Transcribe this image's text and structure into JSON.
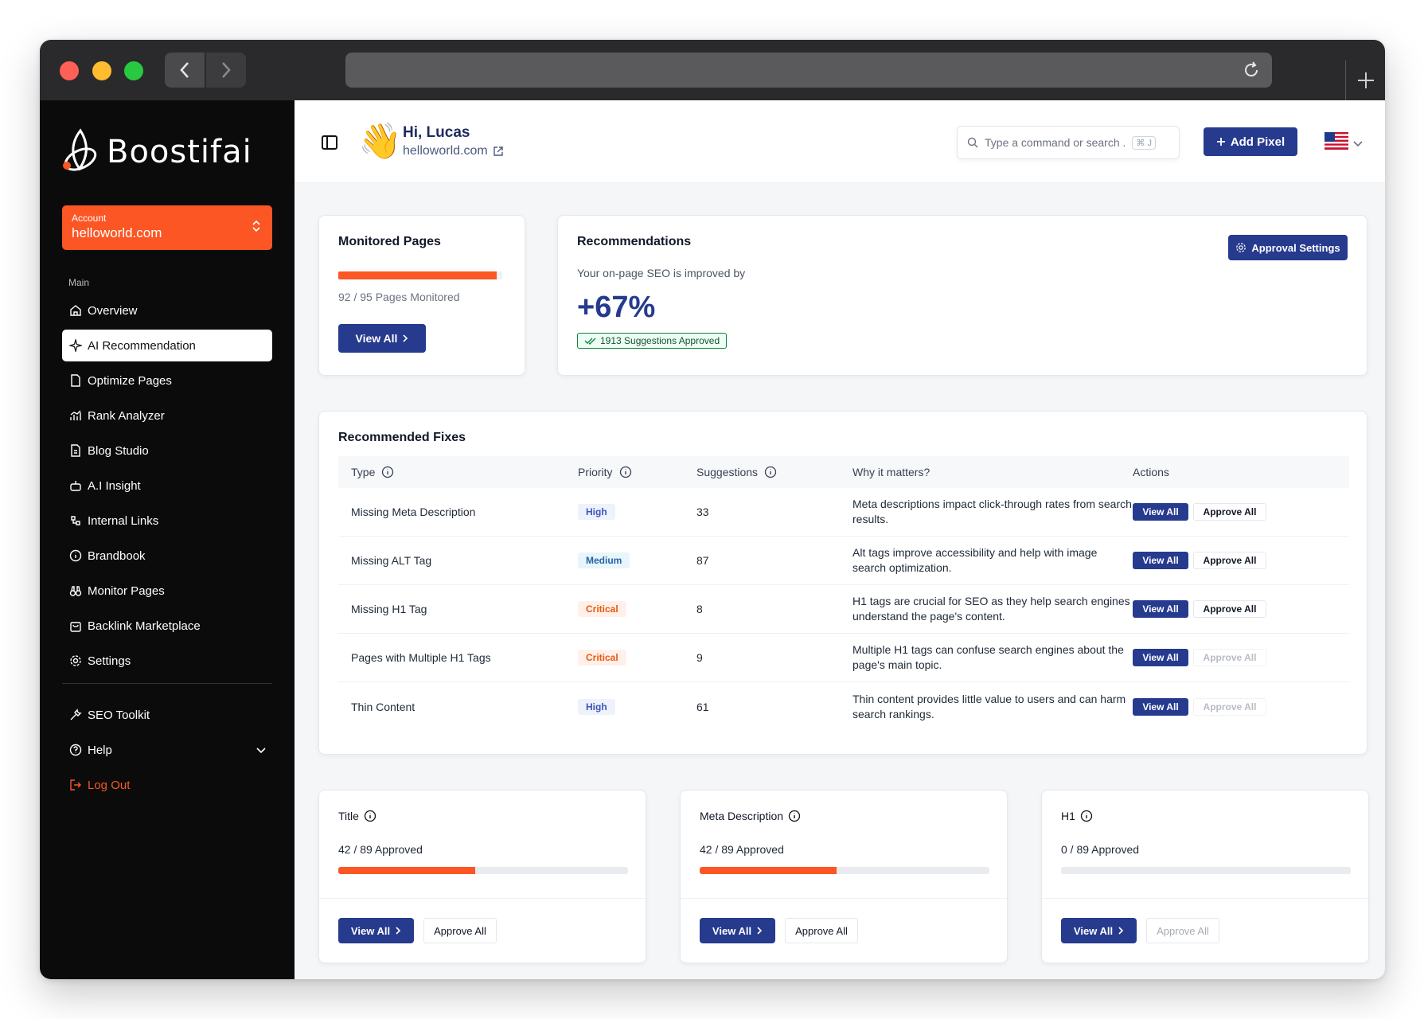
{
  "app": {
    "name": "Boostifai"
  },
  "sidebar": {
    "account_label": "Account",
    "account_value": "helloworld.com",
    "section_main": "Main",
    "items": [
      {
        "label": "Overview",
        "icon": "home-icon"
      },
      {
        "label": "AI Recommendation",
        "icon": "sparkle-icon"
      },
      {
        "label": "Optimize Pages",
        "icon": "file-icon"
      },
      {
        "label": "Rank Analyzer",
        "icon": "chart-icon"
      },
      {
        "label": "Blog Studio",
        "icon": "document-icon"
      },
      {
        "label": "A.I Insight",
        "icon": "robot-icon"
      },
      {
        "label": "Internal Links",
        "icon": "link-icon"
      },
      {
        "label": "Brandbook",
        "icon": "info-icon"
      },
      {
        "label": "Monitor Pages",
        "icon": "binoculars-icon"
      },
      {
        "label": "Backlink Marketplace",
        "icon": "bag-icon"
      },
      {
        "label": "Settings",
        "icon": "gear-icon"
      }
    ],
    "bottom_items": [
      {
        "label": "SEO Toolkit",
        "icon": "wrench-icon"
      },
      {
        "label": "Help",
        "icon": "help-icon"
      },
      {
        "label": "Log Out",
        "icon": "logout-icon"
      }
    ]
  },
  "header": {
    "greeting": "Hi, Lucas",
    "site": "helloworld.com",
    "search_placeholder": "Type a command or search .",
    "search_shortcut": "⌘ J",
    "add_pixel_label": "Add Pixel"
  },
  "monitored": {
    "title": "Monitored Pages",
    "progress": 0.968,
    "text": "92 / 95 Pages Monitored",
    "button": "View All"
  },
  "recommendations": {
    "title": "Recommendations",
    "subtitle": "Your on-page SEO is improved by",
    "improvement": "+67%",
    "approved_badge": "1913 Suggestions Approved",
    "settings_button": "Approval Settings"
  },
  "fixes": {
    "title": "Recommended Fixes",
    "headers": [
      "Type",
      "Priority",
      "Suggestions",
      "Why it matters?",
      "Actions"
    ],
    "view_label": "View All",
    "approve_label": "Approve All",
    "rows": [
      {
        "type": "Missing Meta Description",
        "priority": "High",
        "suggestions": "33",
        "why": "Meta descriptions impact click-through rates from search results."
      },
      {
        "type": "Missing ALT Tag",
        "priority": "Medium",
        "suggestions": "87",
        "why": "Alt tags improve accessibility and help with image search optimization."
      },
      {
        "type": "Missing H1 Tag",
        "priority": "Critical",
        "suggestions": "8",
        "why": "H1 tags are crucial for SEO as they help search engines understand the page's content."
      },
      {
        "type": "Pages with Multiple H1 Tags",
        "priority": "Critical",
        "suggestions": "9",
        "why": "Multiple H1 tags can confuse search engines about the page's main topic."
      },
      {
        "type": "Thin Content",
        "priority": "High",
        "suggestions": "61",
        "why": "Thin content provides little value to users and can harm search rankings."
      }
    ]
  },
  "mini_cards": [
    {
      "title": "Title",
      "count": "42 / 89 Approved",
      "progress": 0.472,
      "view": "View All",
      "approve": "Approve All"
    },
    {
      "title": "Meta Description",
      "count": "42 / 89 Approved",
      "progress": 0.472,
      "view": "View All",
      "approve": "Approve All"
    },
    {
      "title": "H1",
      "count": "0 / 89 Approved",
      "progress": 0,
      "view": "View All",
      "approve": "Approve All"
    }
  ],
  "colors": {
    "accent": "#263a8e",
    "orange": "#fb5624",
    "sidebar": "#0b0b0b"
  }
}
